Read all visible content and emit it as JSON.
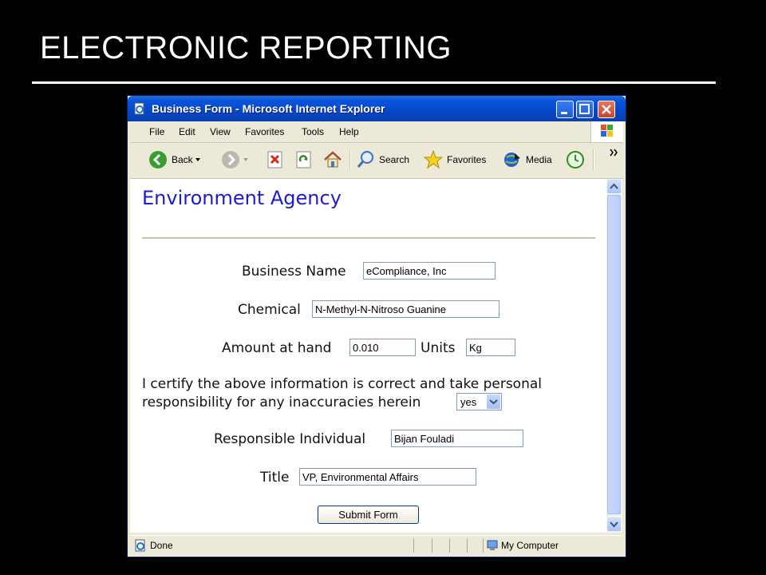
{
  "slide": {
    "title": "ELECTRONIC REPORTING"
  },
  "window": {
    "title": "Business Form - Microsoft Internet Explorer"
  },
  "menu": [
    "File",
    "Edit",
    "View",
    "Favorites",
    "Tools",
    "Help"
  ],
  "toolbar": {
    "back": "Back",
    "search": "Search",
    "favorites": "Favorites",
    "media": "Media"
  },
  "page": {
    "heading": "Environment Agency",
    "form": {
      "business_name": {
        "label": "Business Name",
        "value": "eCompliance, Inc"
      },
      "chemical": {
        "label": "Chemical",
        "value": "N-Methyl-N-Nitroso Guanine"
      },
      "amount": {
        "label": "Amount at hand",
        "value": "0.010"
      },
      "units": {
        "label": "Units",
        "value": "Kg"
      },
      "certify": {
        "text": "I certify the above information is correct and take personal responsibility for any inaccuracies herein",
        "selected": "yes"
      },
      "individual": {
        "label": "Responsible Individual",
        "value": "Bijan Fouladi"
      },
      "title": {
        "label": "Title",
        "value": "VP, Environmental Affairs"
      },
      "submit": "Submit Form"
    }
  },
  "status": {
    "text": "Done",
    "zone": "My Computer"
  },
  "colors": {
    "heading": "#1b1bd6",
    "titlebar": "#0855dd",
    "chrome": "#ece9d8"
  }
}
